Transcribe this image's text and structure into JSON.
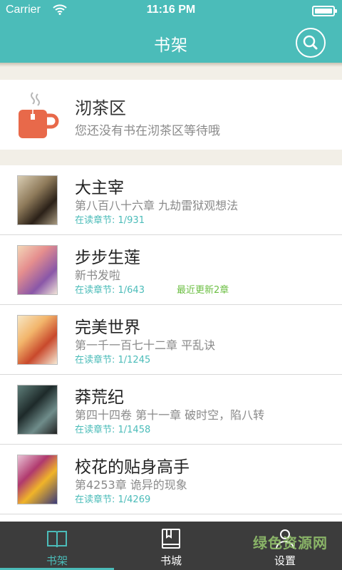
{
  "status_bar": {
    "carrier": "Carrier",
    "time": "11:16 PM"
  },
  "header": {
    "title": "书架",
    "search_icon": "search-icon"
  },
  "tea_area": {
    "title": "沏茶区",
    "subtitle": "您还没有书在沏茶区等待哦",
    "icon": "tea-cup-icon"
  },
  "books": [
    {
      "title": "大主宰",
      "chapter": "第八百八十六章 九劫雷狱观想法",
      "progress": "在读章节: 1/931",
      "update": ""
    },
    {
      "title": "步步生莲",
      "chapter": "新书发啦",
      "progress": "在读章节: 1/643",
      "update": "最近更新2章"
    },
    {
      "title": "完美世界",
      "chapter": "第一千一百七十二章 平乱诀",
      "progress": "在读章节: 1/1245",
      "update": ""
    },
    {
      "title": "莽荒纪",
      "chapter": "第四十四卷 第十一章 破时空，陷八转",
      "progress": "在读章节: 1/1458",
      "update": ""
    },
    {
      "title": "校花的贴身高手",
      "chapter": "第4253章 诡异的现象",
      "progress": "在读章节: 1/4269",
      "update": ""
    }
  ],
  "tabbar": {
    "tabs": [
      {
        "label": "书架",
        "icon": "book-open-icon",
        "active": true
      },
      {
        "label": "书城",
        "icon": "book-icon",
        "active": false
      },
      {
        "label": "设置",
        "icon": "user-icon",
        "active": false
      }
    ]
  },
  "watermark": "绿色资源网",
  "colors": {
    "accent": "#4bbcb9",
    "update_green": "#6cbf43",
    "tea_cup": "#e8694a",
    "tabbar_bg": "#3c3c3c"
  }
}
